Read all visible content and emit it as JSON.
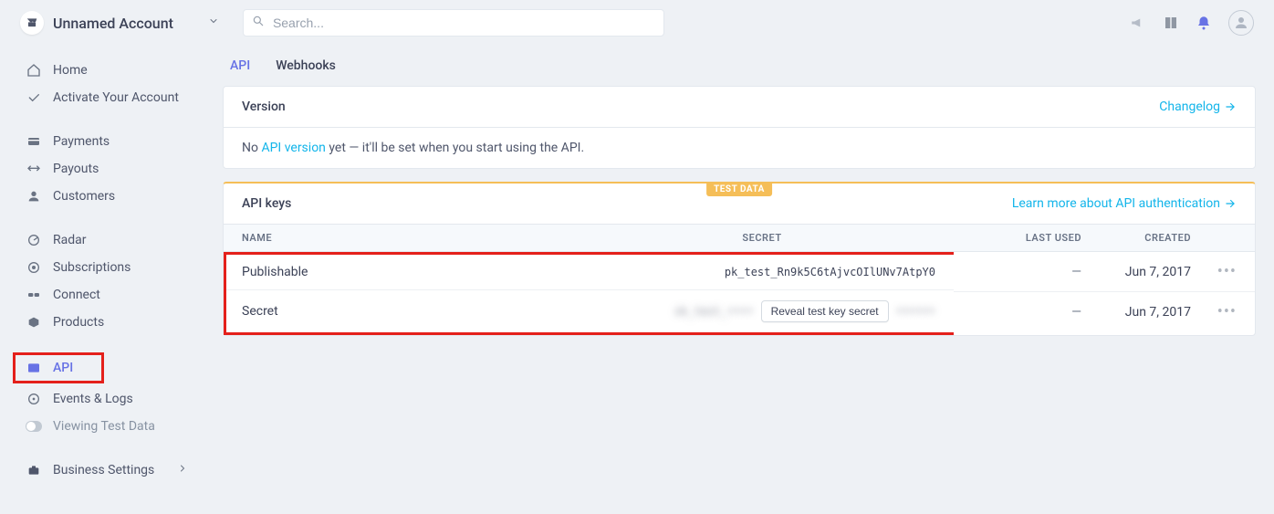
{
  "account": {
    "name": "Unnamed Account"
  },
  "search": {
    "placeholder": "Search..."
  },
  "sidebar": {
    "home": "Home",
    "activate": "Activate Your Account",
    "payments": "Payments",
    "payouts": "Payouts",
    "customers": "Customers",
    "radar": "Radar",
    "subscriptions": "Subscriptions",
    "connect": "Connect",
    "products": "Products",
    "api": "API",
    "events": "Events & Logs",
    "viewing": "Viewing Test Data",
    "business": "Business Settings"
  },
  "tabs": {
    "api": "API",
    "webhooks": "Webhooks"
  },
  "version_card": {
    "title": "Version",
    "changelog": "Changelog",
    "body_prefix": "No ",
    "body_link": "API version",
    "body_suffix": " yet — it'll be set when you start using the API."
  },
  "keys_card": {
    "badge": "TEST DATA",
    "title": "API keys",
    "learn": "Learn more about API authentication",
    "columns": {
      "name": "NAME",
      "secret": "SECRET",
      "last_used": "LAST USED",
      "created": "CREATED"
    },
    "rows": [
      {
        "name": "Publishable",
        "secret": "pk_test_Rn9k5C6tAjvcOIlUNv7AtpY0",
        "last_used": "—",
        "created": "Jun 7, 2017"
      },
      {
        "name": "Secret",
        "secret_hidden_left": "sk_test_••••",
        "reveal_label": "Reveal test key secret",
        "secret_hidden_right": "••••••",
        "last_used": "—",
        "created": "Jun 7, 2017"
      }
    ]
  }
}
